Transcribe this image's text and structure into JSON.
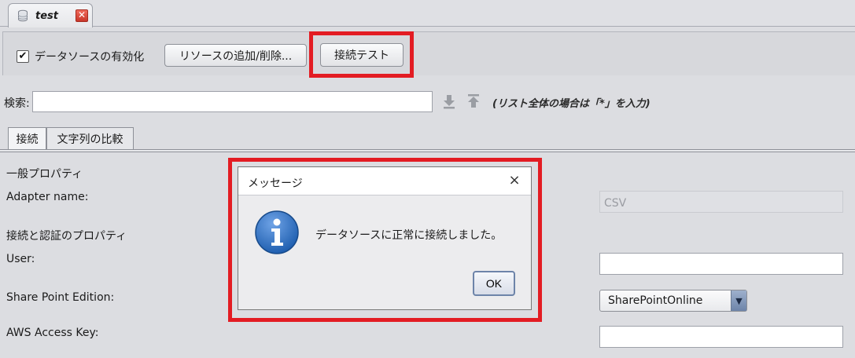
{
  "tab": {
    "title": "test",
    "close_icon": "close-x-icon"
  },
  "toolbar": {
    "enable_label": "データソースの有効化",
    "enable_checked": true,
    "add_remove_label": "リソースの追加/削除...",
    "test_label": "接続テスト"
  },
  "search": {
    "label": "検索:",
    "value": "",
    "hint": "(リスト全体の場合は「*」を入力)"
  },
  "inner_tabs": [
    {
      "label": "接続",
      "active": true
    },
    {
      "label": "文字列の比較",
      "active": false
    }
  ],
  "properties": {
    "general_header": "一般プロパティ",
    "adapter_name_label": "Adapter name:",
    "adapter_name_value": "CSV",
    "auth_header": "接続と認証のプロパティ",
    "user_label": "User:",
    "user_value": "",
    "sp_edition_label": "Share Point Edition:",
    "sp_edition_value": "SharePointOnline",
    "aws_key_label": "AWS Access Key:",
    "aws_key_value": ""
  },
  "dialog": {
    "title": "メッセージ",
    "message": "データソースに正常に接続しました。",
    "ok_label": "OK"
  },
  "colors": {
    "highlight": "#e31c23",
    "info_blue": "#1f5fb0"
  }
}
